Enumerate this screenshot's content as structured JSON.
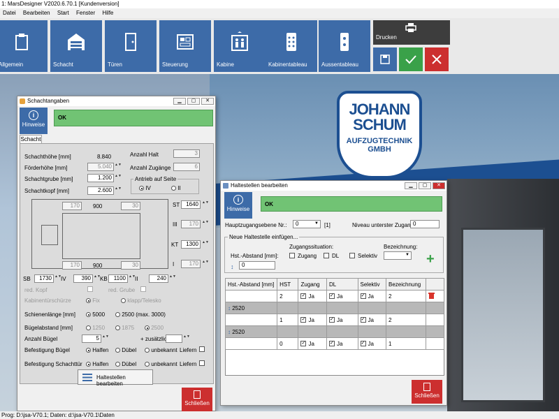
{
  "window": {
    "title": "1: MarsDesigner V2020.6.70.1 [Kundenversion]"
  },
  "menu": [
    "Datei",
    "Bearbeiten",
    "Start",
    "Fenster",
    "Hilfe"
  ],
  "ribbon": {
    "buttons": [
      {
        "id": "allgemein",
        "label": "Allgemein",
        "icon": "clipboard-icon"
      },
      {
        "id": "schacht",
        "label": "Schacht",
        "icon": "garage-icon"
      },
      {
        "id": "tueren",
        "label": "Türen",
        "icon": "door-icon"
      },
      {
        "id": "steuerung",
        "label": "Steuerung",
        "icon": "control-panel-icon"
      },
      {
        "id": "kabine",
        "label": "Kabine",
        "icon": "elevator-icon"
      },
      {
        "id": "kabinentableau",
        "label": "Kabinentableau",
        "icon": "keypad-icon"
      },
      {
        "id": "aussentableau",
        "label": "Aussentableau",
        "icon": "call-button-icon"
      }
    ],
    "print_label": "Drucken"
  },
  "logo": {
    "line1": "JOHANN",
    "line2": "SCHUM",
    "line3": "AUFZUGTECHNIK",
    "line4": "GMBH"
  },
  "status_bar": "Prog: D:\\jsa-V70.1; Daten: d:\\jsa-V70.1\\Daten",
  "schacht_window": {
    "title": "Schachtangaben",
    "hinweise": "Hinweise",
    "ok_text": "OK",
    "tab": "Schacht",
    "schachthoehe_label": "Schachthöhe [mm]",
    "schachthoehe_value": "8.840",
    "foerderhoehe_label": "Förderhöhe  [mm]",
    "foerderhoehe_value": "5.040",
    "schachtgrube_label": "Schachtgrube  [mm]",
    "schachtgrube_value": "1.200",
    "schachtkopf_label": "Schachtkopf  [mm]",
    "schachtkopf_value": "2.600",
    "anzahl_halt_label": "Anzahl Halt",
    "anzahl_halt_value": "3",
    "anzahl_zugaenge_label": "Anzahl Zugänge",
    "anzahl_zugaenge_value": "6",
    "antrieb_label": "Antrieb auf Seite",
    "antrieb_iv": "IV",
    "antrieb_ii": "II",
    "plan": {
      "top_left": "170",
      "top_mid": "900",
      "top_right": "30",
      "bot_left": "170",
      "bot_mid": "900",
      "bot_right": "30",
      "st_label": "ST",
      "st_value": "1640",
      "iii_label": "III",
      "iii_value": "170",
      "kt_label": "KT",
      "kt_value": "1300",
      "i_label": "I",
      "i_value": "170",
      "sb_label": "SB",
      "sb_value": "1730",
      "iv_label": "IV",
      "iv_value": "390",
      "kb_label": "KB",
      "kb_value": "1100",
      "ii_label": "II",
      "ii_value": "240"
    },
    "red_kopf": "red. Kopf",
    "red_grube": "red. Grube",
    "kabinentuerschuerze": "Kabinentürschürze",
    "fix": "Fix",
    "klapp": "klapp/Telesko",
    "schienenlaenge_label": "Schienenlänge [mm]",
    "schienen_5000": "5000",
    "schienen_2500": "2500 (max. 3000)",
    "buegelabstand_label": "Bügelabstand [mm]",
    "buegel_1250": "1250",
    "buegel_1875": "1875",
    "buegel_2500": "2500",
    "anzahl_buegel_label": "Anzahl Bügel",
    "anzahl_buegel_value": "5",
    "zusaetzlich_label": "+ zusätzlich",
    "befestigung_buegel_label": "Befestigung Bügel",
    "befestigung_schachttuer_label": "Befestigung  Schachttür",
    "halfen": "Halfen",
    "duebel": "Dübel",
    "unbekannt": "unbekannt",
    "liefern": "Liefern",
    "haltestellen_btn": "Haltestellen bearbeiten",
    "schliessen": "Schließen"
  },
  "halt_window": {
    "title": "Haltestellen bearbeiten",
    "hinweise": "Hinweise",
    "ok_text": "OK",
    "hauptzugang_label": "Hauptzugangsebene Nr.:",
    "hauptzugang_value": "0",
    "hauptzugang_extra": "[1]",
    "niveau_label": "Niveau unterster Zugang:",
    "niveau_value": "0",
    "group_title": "Neue Haltestelle einfügen...",
    "hst_abstand_label": "Hst.-Abstand [mm]:",
    "hst_abstand_value": "0",
    "zugangssituation_label": "Zugangssituation:",
    "zugang": "Zugang",
    "dl": "DL",
    "selektiv": "Selektiv",
    "bezeichnung_label": "Bezeichnung:",
    "columns": [
      "Hst.-Abstand [mm]",
      "HST",
      "Zugang",
      "DL",
      "Selektiv",
      "Bezeichnung"
    ],
    "rows": [
      {
        "kind": "stop",
        "hst": "2",
        "zugang": "Ja",
        "dl": "Ja",
        "selektiv": "Ja",
        "bez": "2"
      },
      {
        "kind": "gap",
        "abstand": "2520"
      },
      {
        "kind": "stop",
        "hst": "1",
        "zugang": "Ja",
        "dl": "Ja",
        "selektiv": "Ja",
        "bez": "2"
      },
      {
        "kind": "gap",
        "abstand": "2520"
      },
      {
        "kind": "stop",
        "hst": "0",
        "zugang": "Ja",
        "dl": "Ja",
        "selektiv": "Ja",
        "bez": "1"
      }
    ],
    "schliessen": "Schließen"
  },
  "colors": {
    "ribbon_blue": "#3d6ba8",
    "ok_green": "#71c374",
    "close_red": "#cc2f2f",
    "accept_green": "#3aa149"
  }
}
